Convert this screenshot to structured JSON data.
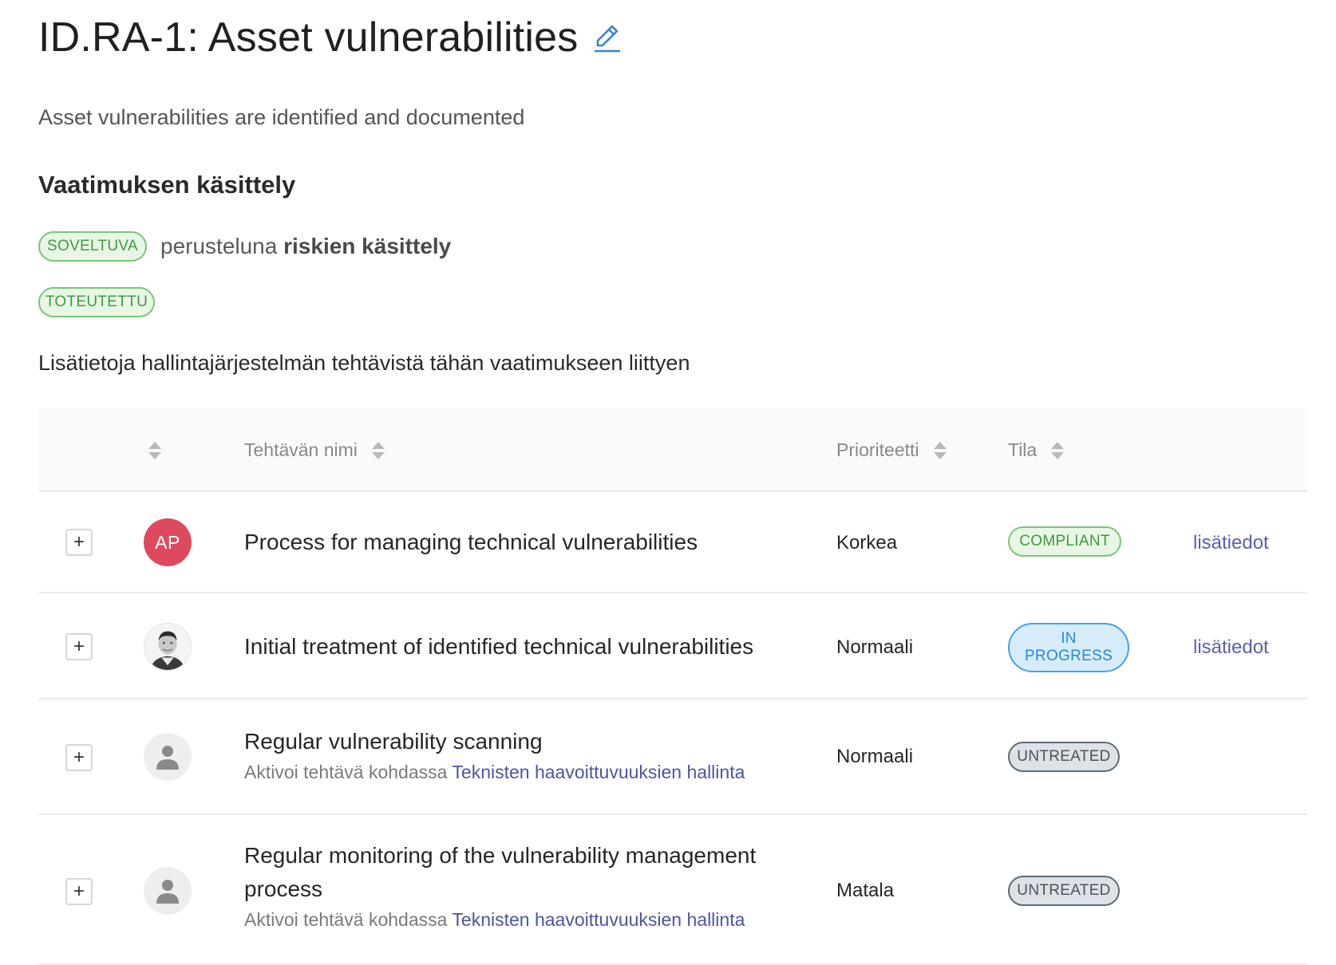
{
  "header": {
    "title": "ID.RA-1: Asset vulnerabilities",
    "subtitle": "Asset vulnerabilities are identified and documented"
  },
  "requirement": {
    "heading": "Vaatimuksen käsittely",
    "applicability_badge": "SOVELTUVA",
    "justification_prefix": "perusteluna",
    "justification_value": "riskien käsittely",
    "implementation_badge": "TOTEUTETTU",
    "info_text": "Lisätietoja hallintajärjestelmän tehtävistä tähän vaatimukseen liittyen"
  },
  "table": {
    "columns": {
      "name": "Tehtävän nimi",
      "priority": "Prioriteetti",
      "status": "Tila"
    },
    "rows": [
      {
        "avatar": "AP",
        "name": "Process for managing technical vulnerabilities",
        "priority": "Korkea",
        "status": "COMPLIANT",
        "details": "lisätiedot"
      },
      {
        "avatar": "photo",
        "name": "Initial treatment of identified technical vulnerabilities",
        "priority": "Normaali",
        "status": "IN PROGRESS",
        "details": "lisätiedot"
      },
      {
        "avatar": "person-icon",
        "name": "Regular vulnerability scanning",
        "hint_prefix": "Aktivoi tehtävä kohdassa",
        "hint_link": "Teknisten haavoittuvuuksien hallinta",
        "priority": "Normaali",
        "status": "UNTREATED"
      },
      {
        "avatar": "person-icon",
        "name": "Regular monitoring of the vulnerability management process",
        "hint_prefix": "Aktivoi tehtävä kohdassa",
        "hint_link": "Teknisten haavoittuvuuksien hallinta",
        "priority": "Matala",
        "status": "UNTREATED"
      }
    ]
  },
  "colors": {
    "accent_link": "#4e54a8",
    "compliant": "#3f9a3e",
    "in_progress": "#2a86d6",
    "untreated": "#4a545e",
    "avatar_initials_bg": "#de4a5d"
  }
}
